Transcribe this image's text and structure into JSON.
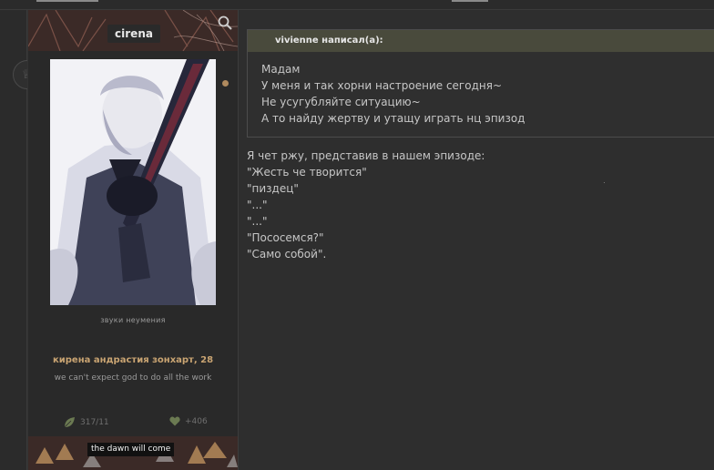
{
  "profile": {
    "username": "cirena",
    "subtitle": "звуки неумения",
    "character": "кирена андрастия зонхарт, 28",
    "motto": "we can't expect god to do all the work",
    "posts": "317/11",
    "reputation": "+406",
    "tagline": "the dawn will come"
  },
  "quote": {
    "header": "vivienne написал(а):",
    "lines": [
      "Мадам",
      "У меня и так хорни настроение сегодня~",
      "Не усугубляйте ситуацию~",
      "А то найду жертву и утащу играть нц эпизод"
    ]
  },
  "post": {
    "lines": [
      "Я чет ржу, представив в нашем эпизоде:",
      "\"Жесть че творится\"",
      "\"пиздец\"",
      "\"...\"",
      "\"...\"",
      "\"Пососемся?\"",
      "\"Само собой\"."
    ]
  },
  "icons": {
    "search": "search-icon",
    "posts": "leaf-icon",
    "reputation": "heart-icon",
    "rank": "crown-icon"
  },
  "colors": {
    "accent": "#c9a472",
    "quote_header": "#494a3c",
    "pattern": "#3b2a27"
  }
}
